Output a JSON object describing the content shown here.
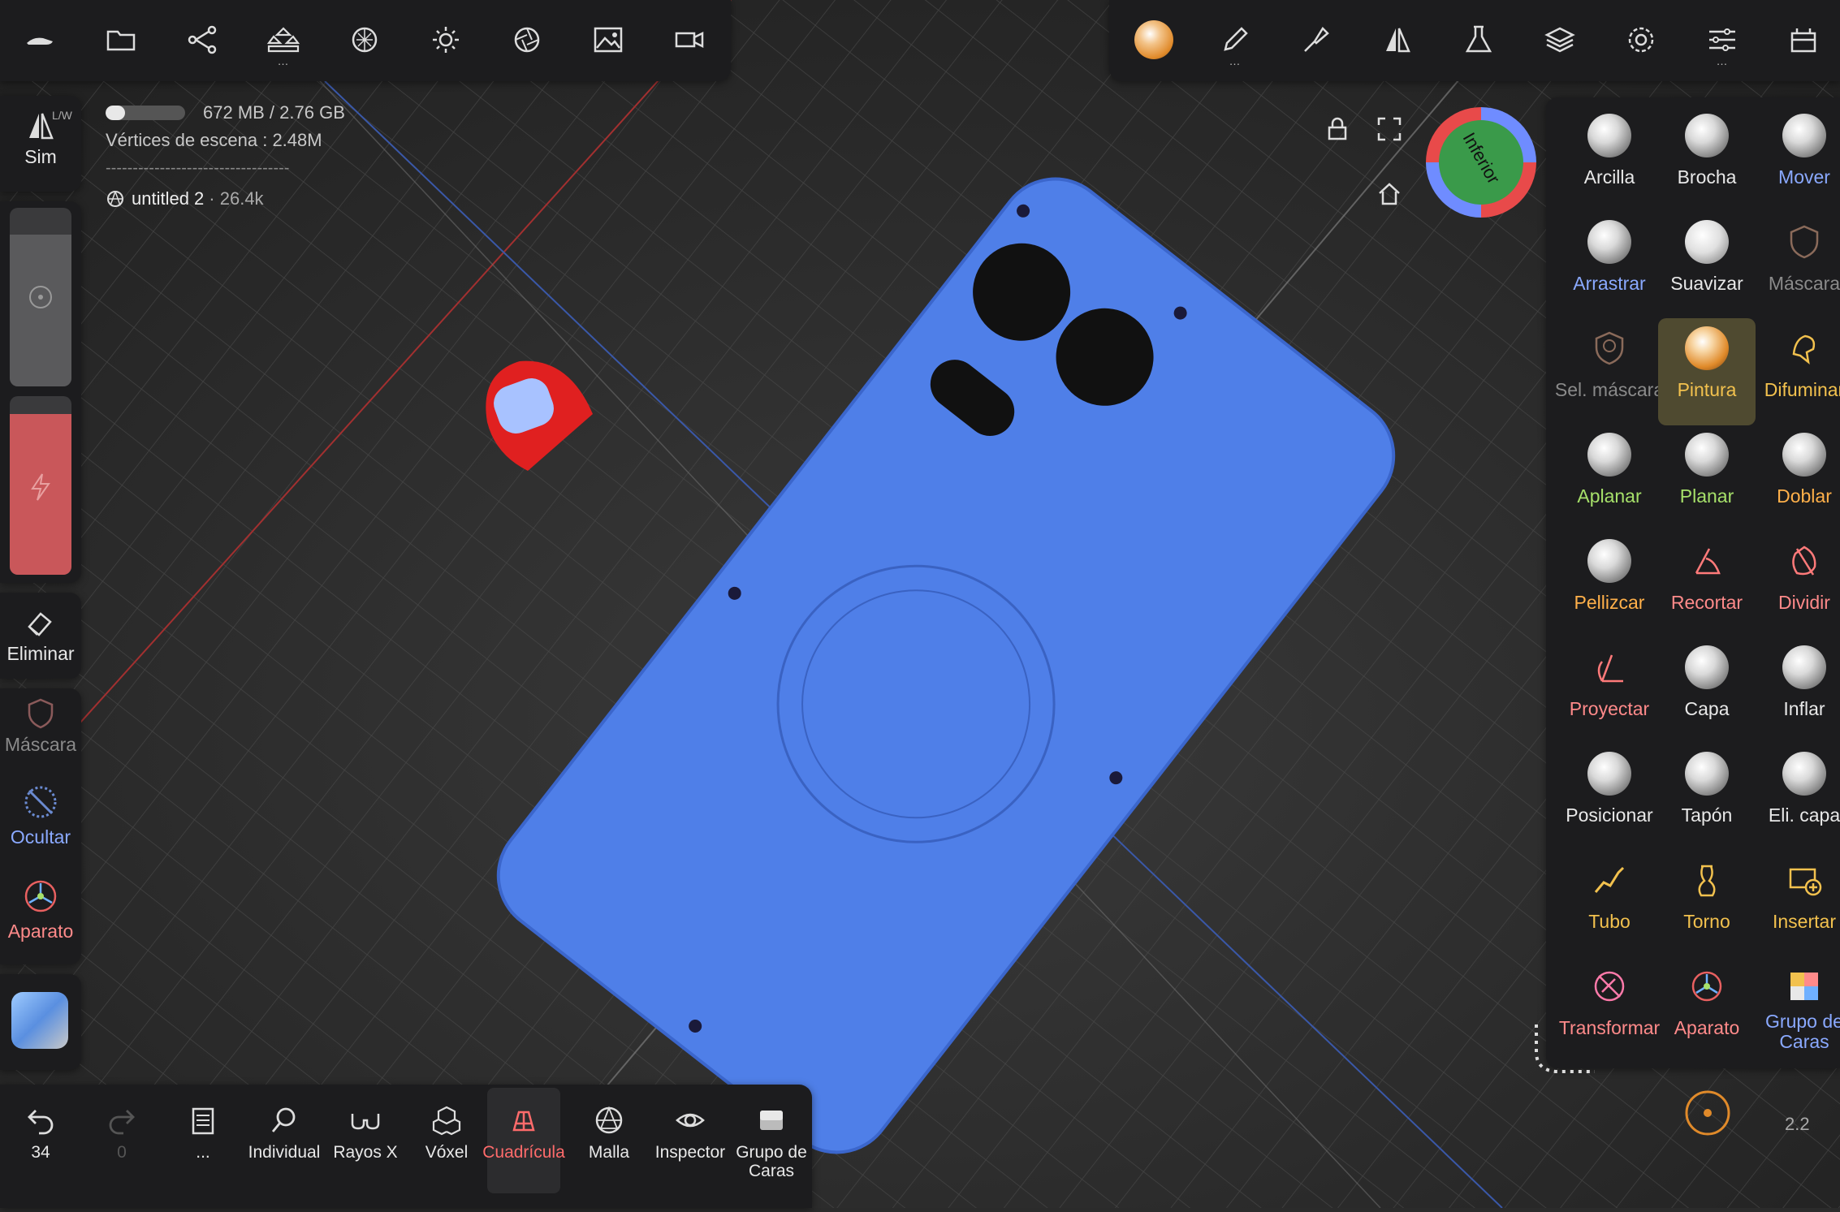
{
  "colors": {
    "accent_yellow": "#f2c14e",
    "accent_blue": "#8aa9ff",
    "mask_gray": "#8a8a8a",
    "green": "#a6e06a",
    "pink": "#ff8a8a",
    "orange": "#ffb04a",
    "model_blue": "#4f7fe8",
    "red_part": "#e02020"
  },
  "top_left_toolbar": {
    "icons": [
      "shoe-icon",
      "folder-icon",
      "scene-graph-icon",
      "primitives-icon",
      "material-icon",
      "light-icon",
      "camera-aperture-icon",
      "image-icon",
      "video-icon"
    ]
  },
  "top_right_toolbar": {
    "icons": [
      "paint-sphere-icon",
      "pen-icon",
      "brush-icon",
      "symmetry-icon",
      "flask-icon",
      "layers-icon",
      "settings-gear-icon",
      "sliders-icon",
      "plugin-icon"
    ]
  },
  "stats": {
    "memory": "672 MB / 2.76 GB",
    "memory_fraction": 0.24,
    "vertices": "Vértices de escena : 2.48M",
    "divider": "----------------------------------",
    "object_name": "untitled 2",
    "object_count": "· 26.4k"
  },
  "left_panel": {
    "sym_label": "Sim",
    "sym_tag": "L/W",
    "radius_level": 0.85,
    "intensity_level": 0.9,
    "delete_label": "Eliminar",
    "mask_label": "Máscara",
    "hide_label": "Ocultar",
    "gizmo_label": "Aparato"
  },
  "view_cube": {
    "face_label": "Inferior"
  },
  "tools": [
    {
      "label": "Arcilla",
      "color": "#e8e8e8"
    },
    {
      "label": "Brocha",
      "color": "#e8e8e8"
    },
    {
      "label": "Mover",
      "color": "#8aa9ff"
    },
    {
      "label": "Arrastrar",
      "color": "#8aa9ff"
    },
    {
      "label": "Suavizar",
      "color": "#e8e8e8"
    },
    {
      "label": "Máscara",
      "color": "#8a8a8a"
    },
    {
      "label": "Sel. máscara",
      "color": "#8a8a8a"
    },
    {
      "label": "Pintura",
      "color": "#f2c14e"
    },
    {
      "label": "Difuminar",
      "color": "#f2c14e"
    },
    {
      "label": "Aplanar",
      "color": "#a6e06a"
    },
    {
      "label": "Planar",
      "color": "#a6e06a"
    },
    {
      "label": "Doblar",
      "color": "#ffb04a"
    },
    {
      "label": "Pellizcar",
      "color": "#ffb04a"
    },
    {
      "label": "Recortar",
      "color": "#ff8a8a"
    },
    {
      "label": "Dividir",
      "color": "#ff8a8a"
    },
    {
      "label": "Proyectar",
      "color": "#ff8a8a"
    },
    {
      "label": "Capa",
      "color": "#e8e8e8"
    },
    {
      "label": "Inflar",
      "color": "#e8e8e8"
    },
    {
      "label": "Posicionar",
      "color": "#e8e8e8"
    },
    {
      "label": "Tapón",
      "color": "#e8e8e8"
    },
    {
      "label": "Eli. capa",
      "color": "#e8e8e8"
    },
    {
      "label": "Tubo",
      "color": "#f2c14e"
    },
    {
      "label": "Torno",
      "color": "#f2c14e"
    },
    {
      "label": "Insertar",
      "color": "#f2c14e"
    },
    {
      "label": "Transformar",
      "color": "#ff8a8a"
    },
    {
      "label": "Aparato",
      "color": "#ff8a8a"
    },
    {
      "label": "Grupo de Caras",
      "color": "#8aa9ff"
    }
  ],
  "bottom_bar": {
    "undo_count": "34",
    "redo_count": "0",
    "more_label": "...",
    "items": [
      "Individual",
      "Rayos X",
      "Vóxel",
      "Cuadrícula",
      "Malla",
      "Inspector",
      "Grupo de Caras"
    ]
  },
  "zoom_value": "2.2"
}
